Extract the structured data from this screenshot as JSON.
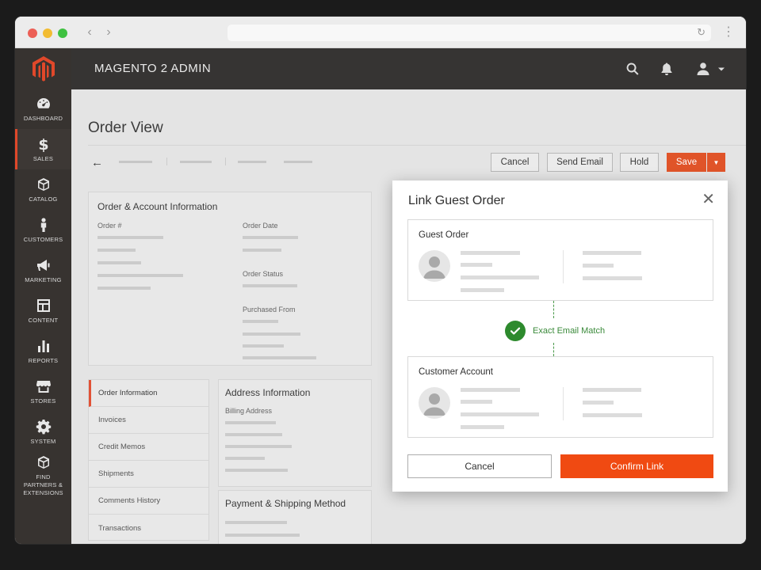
{
  "app": {
    "brand": "MAGENTO 2 ADMIN"
  },
  "sidebar": {
    "items": [
      {
        "label": "DASHBOARD",
        "icon": "gauge-icon"
      },
      {
        "label": "SALES",
        "icon": "dollar-icon",
        "active": true
      },
      {
        "label": "CATALOG",
        "icon": "cube-icon"
      },
      {
        "label": "CUSTOMERS",
        "icon": "person-icon"
      },
      {
        "label": "MARKETING",
        "icon": "megaphone-icon"
      },
      {
        "label": "CONTENT",
        "icon": "layout-icon"
      },
      {
        "label": "REPORTS",
        "icon": "bar-chart-icon"
      },
      {
        "label": "STORES",
        "icon": "storefront-icon"
      },
      {
        "label": "SYSTEM",
        "icon": "gear-icon"
      },
      {
        "label": "FIND PARTNERS & EXTENSIONS",
        "icon": "box-icon"
      }
    ]
  },
  "page": {
    "title": "Order View"
  },
  "toolbar": {
    "cancel_label": "Cancel",
    "send_email_label": "Send Email",
    "hold_label": "Hold",
    "save_label": "Save"
  },
  "order_account": {
    "title": "Order & Account Information",
    "order_number_label": "Order #",
    "order_date_label": "Order Date",
    "order_status_label": "Order Status",
    "purchased_from_label": "Purchased From"
  },
  "tabs": [
    {
      "label": "Order Information",
      "active": true
    },
    {
      "label": "Invoices"
    },
    {
      "label": "Credit Memos"
    },
    {
      "label": "Shipments"
    },
    {
      "label": "Comments History"
    },
    {
      "label": "Transactions"
    }
  ],
  "address": {
    "title": "Address Information",
    "billing_label": "Billing Address"
  },
  "payment": {
    "title": "Payment & Shipping Method"
  },
  "modal": {
    "title": "Link Guest Order",
    "guest_card_title": "Guest Order",
    "customer_card_title": "Customer Account",
    "match_label": "Exact Email Match",
    "cancel_label": "Cancel",
    "confirm_label": "Confirm Link"
  },
  "colors": {
    "accent": "#e0482a",
    "confirm": "#f04a12",
    "match": "#2d8a2d",
    "sidebar": "#373330"
  }
}
